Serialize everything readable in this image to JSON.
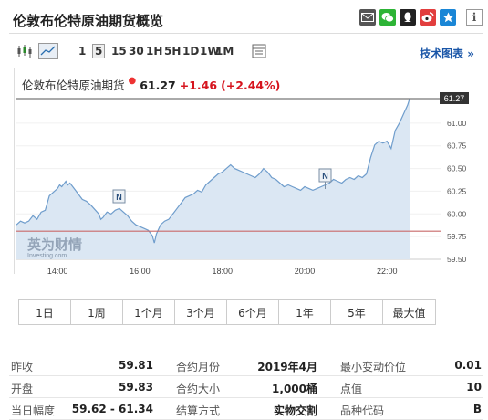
{
  "header": {
    "title": "伦敦布伦特原油期货概览",
    "share_icons": [
      "mail-icon",
      "wechat-icon",
      "qq-icon",
      "weibo-icon",
      "qzone-icon"
    ],
    "info_label": "i"
  },
  "toolbar": {
    "timeframes": [
      "1",
      "5",
      "15",
      "30",
      "1H",
      "5H",
      "1D",
      "1W",
      "1M"
    ],
    "active_timeframe": "5",
    "tech_chart_link": "技术图表 »"
  },
  "quote": {
    "name": "伦敦布伦特原油期货",
    "price": "61.27",
    "change": "+1.46",
    "change_pct": "(+2.44%)"
  },
  "chart_data": {
    "type": "area",
    "x_tick_labels": [
      "14:00",
      "16:00",
      "18:00",
      "20:00",
      "22:00"
    ],
    "y_tick_labels": [
      "61.00",
      "60.75",
      "60.50",
      "60.25",
      "60.00",
      "59.75",
      "59.50"
    ],
    "ylim": [
      59.5,
      61.27
    ],
    "current_price_label": "61.27",
    "reference_line": 59.81,
    "news_marker_label": "N",
    "watermark": "英为财情",
    "watermark_sub": "Investing.com",
    "series_points": [
      [
        13.0,
        59.88
      ],
      [
        13.1,
        59.92
      ],
      [
        13.2,
        59.9
      ],
      [
        13.3,
        59.92
      ],
      [
        13.4,
        59.98
      ],
      [
        13.5,
        59.94
      ],
      [
        13.6,
        60.02
      ],
      [
        13.7,
        60.04
      ],
      [
        13.8,
        60.2
      ],
      [
        13.9,
        60.24
      ],
      [
        14.0,
        60.28
      ],
      [
        14.05,
        60.32
      ],
      [
        14.1,
        60.3
      ],
      [
        14.2,
        60.36
      ],
      [
        14.25,
        60.32
      ],
      [
        14.3,
        60.34
      ],
      [
        14.4,
        60.28
      ],
      [
        14.5,
        60.22
      ],
      [
        14.6,
        60.16
      ],
      [
        14.7,
        60.14
      ],
      [
        14.8,
        60.1
      ],
      [
        14.9,
        60.05
      ],
      [
        15.0,
        60.0
      ],
      [
        15.05,
        59.94
      ],
      [
        15.1,
        59.96
      ],
      [
        15.2,
        60.02
      ],
      [
        15.3,
        60.0
      ],
      [
        15.4,
        60.04
      ],
      [
        15.5,
        60.06
      ],
      [
        15.6,
        60.02
      ],
      [
        15.7,
        59.98
      ],
      [
        15.8,
        59.92
      ],
      [
        15.9,
        59.88
      ],
      [
        16.0,
        59.86
      ],
      [
        16.1,
        59.84
      ],
      [
        16.2,
        59.82
      ],
      [
        16.3,
        59.76
      ],
      [
        16.35,
        59.68
      ],
      [
        16.4,
        59.78
      ],
      [
        16.5,
        59.88
      ],
      [
        16.6,
        59.92
      ],
      [
        16.7,
        59.94
      ],
      [
        16.8,
        60.0
      ],
      [
        16.9,
        60.06
      ],
      [
        17.0,
        60.12
      ],
      [
        17.1,
        60.18
      ],
      [
        17.2,
        60.2
      ],
      [
        17.3,
        60.22
      ],
      [
        17.4,
        60.26
      ],
      [
        17.5,
        60.24
      ],
      [
        17.6,
        60.32
      ],
      [
        17.7,
        60.36
      ],
      [
        17.8,
        60.4
      ],
      [
        17.9,
        60.44
      ],
      [
        18.0,
        60.46
      ],
      [
        18.1,
        60.5
      ],
      [
        18.2,
        60.54
      ],
      [
        18.3,
        60.5
      ],
      [
        18.4,
        60.48
      ],
      [
        18.5,
        60.46
      ],
      [
        18.6,
        60.44
      ],
      [
        18.7,
        60.42
      ],
      [
        18.8,
        60.4
      ],
      [
        18.9,
        60.44
      ],
      [
        19.0,
        60.5
      ],
      [
        19.1,
        60.46
      ],
      [
        19.2,
        60.4
      ],
      [
        19.3,
        60.38
      ],
      [
        19.4,
        60.34
      ],
      [
        19.5,
        60.3
      ],
      [
        19.6,
        60.32
      ],
      [
        19.7,
        60.3
      ],
      [
        19.8,
        60.28
      ],
      [
        19.9,
        60.26
      ],
      [
        20.0,
        60.3
      ],
      [
        20.1,
        60.28
      ],
      [
        20.2,
        60.26
      ],
      [
        20.3,
        60.28
      ],
      [
        20.4,
        60.3
      ],
      [
        20.5,
        60.32
      ],
      [
        20.6,
        60.34
      ],
      [
        20.7,
        60.38
      ],
      [
        20.8,
        60.36
      ],
      [
        20.9,
        60.34
      ],
      [
        21.0,
        60.38
      ],
      [
        21.1,
        60.4
      ],
      [
        21.2,
        60.38
      ],
      [
        21.3,
        60.42
      ],
      [
        21.4,
        60.4
      ],
      [
        21.5,
        60.44
      ],
      [
        21.6,
        60.62
      ],
      [
        21.7,
        60.76
      ],
      [
        21.8,
        60.8
      ],
      [
        21.9,
        60.78
      ],
      [
        22.0,
        60.8
      ],
      [
        22.1,
        60.72
      ],
      [
        22.2,
        60.92
      ],
      [
        22.3,
        61.0
      ],
      [
        22.4,
        61.1
      ],
      [
        22.5,
        61.2
      ],
      [
        22.55,
        61.27
      ]
    ],
    "x_range": [
      13.0,
      23.3
    ]
  },
  "ranges": [
    "1日",
    "1周",
    "1个月",
    "3个月",
    "6个月",
    "1年",
    "5年",
    "最大值"
  ],
  "stats": [
    {
      "l1": "昨收",
      "v1": "59.81",
      "l2": "合约月份",
      "v2": "2019年4月",
      "l3": "最小变动价位",
      "v3": "0.01"
    },
    {
      "l1": "开盘",
      "v1": "59.83",
      "l2": "合约大小",
      "v2": "1,000桶",
      "l3": "点值",
      "v3": "10"
    },
    {
      "l1": "当日幅度",
      "v1": "59.62 - 61.34",
      "l2": "结算方式",
      "v2": "实物交割",
      "l3": "品种代码",
      "v3": "B"
    }
  ]
}
